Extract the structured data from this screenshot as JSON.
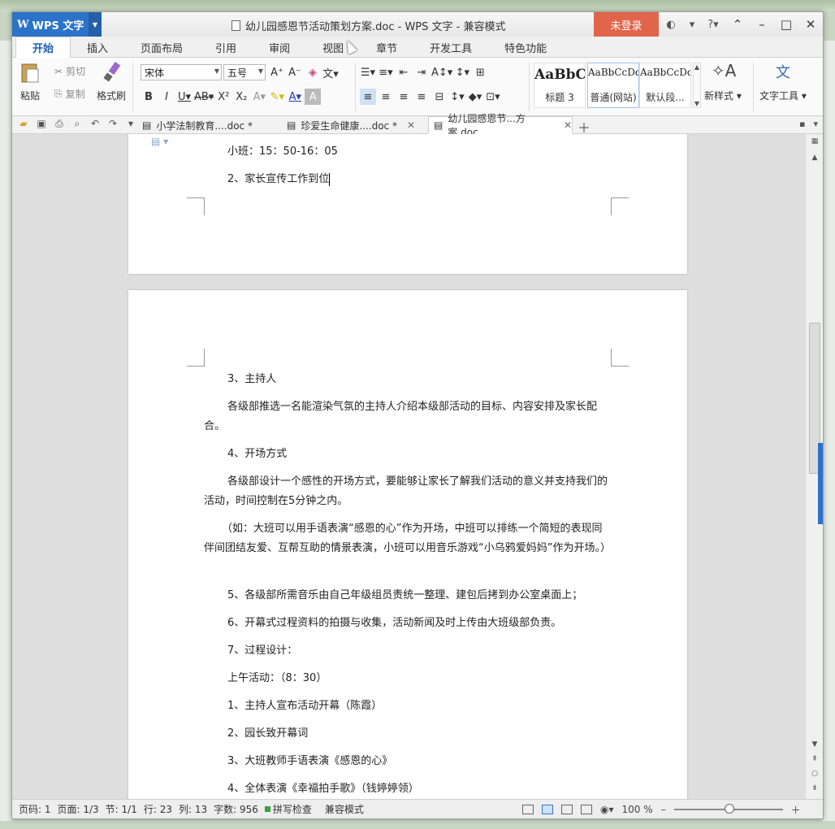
{
  "app": {
    "name": "WPS 文字",
    "window_title": "幼儿园感恩节活动策划方案.doc - WPS 文字 - 兼容模式",
    "login_label": "未登录"
  },
  "ribbon_tabs": [
    "开始",
    "插入",
    "页面布局",
    "引用",
    "审阅",
    "视图",
    "章节",
    "开发工具",
    "特色功能"
  ],
  "ribbon": {
    "paste_label": "粘贴",
    "cut_label": "剪切",
    "copy_label": "复制",
    "format_painter_label": "格式刷",
    "font_name": "宋体",
    "font_size": "五号",
    "styles": [
      {
        "preview": "AaBbC",
        "name": "标题 3"
      },
      {
        "preview": "AaBbCcDd",
        "name": "普通(网站)"
      },
      {
        "preview": "AaBbCcDd",
        "name": "默认段..."
      }
    ],
    "new_style_label": "新样式",
    "text_tools_label": "文字工具"
  },
  "doc_tabs": [
    {
      "label": "小学法制教育....doc *"
    },
    {
      "label": "珍爱生命健康....doc *"
    },
    {
      "label": "幼儿园感恩节...方案.doc"
    }
  ],
  "document": {
    "page1_lines": [
      "小班：15：50-16：05",
      "2、家长宣传工作到位"
    ],
    "page2_paras": [
      "3、主持人",
      "各级部推选一名能渲染气氛的主持人介绍本级部活动的目标、内容安排及家长配合。",
      "4、开场方式",
      "各级部设计一个感性的开场方式，要能够让家长了解我们活动的意义并支持我们的活动，时间控制在5分钟之内。",
      "（如：大班可以用手语表演“感恩的心”作为开场，中班可以排练一个简短的表现同伴间团结友爱、互帮互助的情景表演，小班可以用音乐游戏“小乌鸦爱妈妈”作为开场。）",
      "5、各级部所需音乐由自己年级组员责统一整理、建包后拷到办公室桌面上；",
      "6、开幕式过程资料的拍摄与收集，活动新闻及时上传由大班级部负责。",
      "7、过程设计：",
      "上午活动：（8：30）",
      "1、主持人宣布活动开幕（陈霞）",
      "2、园长致开幕词",
      "3、大班教师手语表演《感恩的心》",
      "4、全体表演《幸福拍手歌》（钱婷婷领）"
    ]
  },
  "status": {
    "page_code": "页码: 1",
    "page": "页面: 1/3",
    "section": "节: 1/1",
    "row": "行: 23",
    "col": "列: 13",
    "word_count": "字数: 956",
    "spell_check": "拼写检查",
    "compat_mode": "兼容模式",
    "zoom": "100 %",
    "zoom_level": 0.5
  }
}
